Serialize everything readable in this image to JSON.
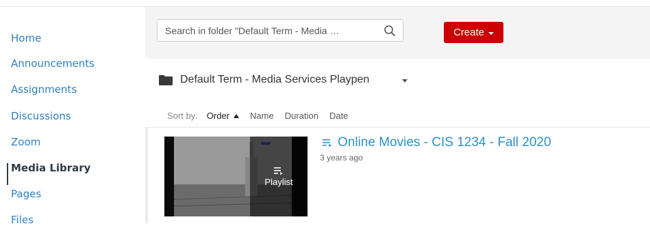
{
  "sidebar": {
    "items": [
      {
        "label": "Home"
      },
      {
        "label": "Announcements"
      },
      {
        "label": "Assignments"
      },
      {
        "label": "Discussions"
      },
      {
        "label": "Zoom"
      },
      {
        "label": "Media Library"
      },
      {
        "label": "Pages"
      },
      {
        "label": "Files"
      }
    ],
    "active_item": "Media Library"
  },
  "toolbar": {
    "search_placeholder": "Search in folder \"Default Term - Media …",
    "search_icon": "search-icon",
    "create_label": "Create"
  },
  "folder": {
    "icon": "folder-icon",
    "name": "Default Term - Media Services Playpen"
  },
  "sort": {
    "label": "Sort by:",
    "options": [
      "Order",
      "Name",
      "Duration",
      "Date"
    ],
    "active": "Order",
    "direction": "ascending"
  },
  "entries": [
    {
      "type_icon": "playlist-icon",
      "title": "Online Movies - CIS 1234 - Fall 2020",
      "meta": "3 years ago",
      "thumb_label": "Playlist"
    }
  ],
  "colors": {
    "link": "#2d7fc3",
    "active_nav": "#2d3b45",
    "create_button": "#cc0000",
    "entry_title": "#2d90c6"
  }
}
